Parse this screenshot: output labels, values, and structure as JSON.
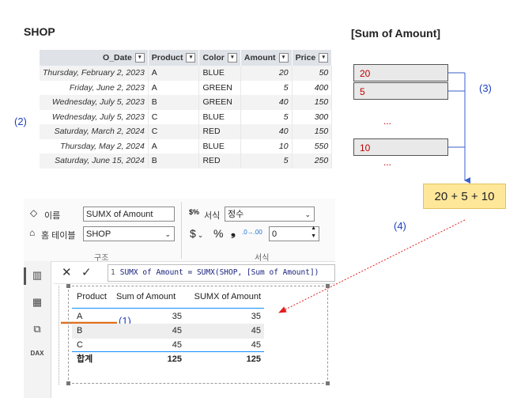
{
  "shop_title": "SHOP",
  "sum_title": "[Sum of Amount]",
  "markers": {
    "m1": "(1)",
    "m2": "(2)",
    "m3": "(3)",
    "m4": "(4)"
  },
  "shop_table": {
    "dropdown_glyph": "▾",
    "headers": [
      "O_Date",
      "Product",
      "Color",
      "Amount",
      "Price"
    ],
    "rows": [
      [
        "Thursday, February 2, 2023",
        "A",
        "BLUE",
        "20",
        "50"
      ],
      [
        "Friday, June 2, 2023",
        "A",
        "GREEN",
        "5",
        "400"
      ],
      [
        "Wednesday, July 5, 2023",
        "B",
        "GREEN",
        "40",
        "150"
      ],
      [
        "Wednesday, July 5, 2023",
        "C",
        "BLUE",
        "5",
        "300"
      ],
      [
        "Saturday, March 2, 2024",
        "C",
        "RED",
        "40",
        "150"
      ],
      [
        "Thursday, May 2, 2024",
        "A",
        "BLUE",
        "10",
        "550"
      ],
      [
        "Saturday, June 15, 2024",
        "B",
        "RED",
        "5",
        "250"
      ]
    ]
  },
  "sum_boxes": {
    "v1": "20",
    "v2": "5",
    "v3": "10",
    "dots": "..."
  },
  "sum_formula": "20 + 5 + 10",
  "ribbon": {
    "name_label": "이름",
    "name_value": "SUMX of Amount",
    "home_table_label": "홈 테이블",
    "home_table_value": "SHOP",
    "structure_caption": "구조",
    "format_label": "서식",
    "format_value": "정수",
    "currency_glyph": "$",
    "percent_glyph": "%",
    "comma_glyph": "❟",
    "decimals_value": "0",
    "format_caption": "서식"
  },
  "formula_bar": {
    "cancel_glyph": "✕",
    "commit_glyph": "✓",
    "line_number": "1",
    "formula": "SUMX of Amount = SUMX(SHOP, [Sum of Amount])"
  },
  "matrix": {
    "headers": [
      "Product",
      "Sum of Amount",
      "SUMX of Amount"
    ],
    "rows": [
      [
        "A",
        "35",
        "35"
      ],
      [
        "B",
        "45",
        "45"
      ],
      [
        "C",
        "45",
        "45"
      ]
    ],
    "total": [
      "합계",
      "125",
      "125"
    ]
  },
  "colors": {
    "annotation_blue": "#1f3fbf",
    "value_red": "#c00000",
    "formula_box": "#ffe79a",
    "matrix_accent": "#118dff",
    "marker_orange": "#e0701e"
  }
}
